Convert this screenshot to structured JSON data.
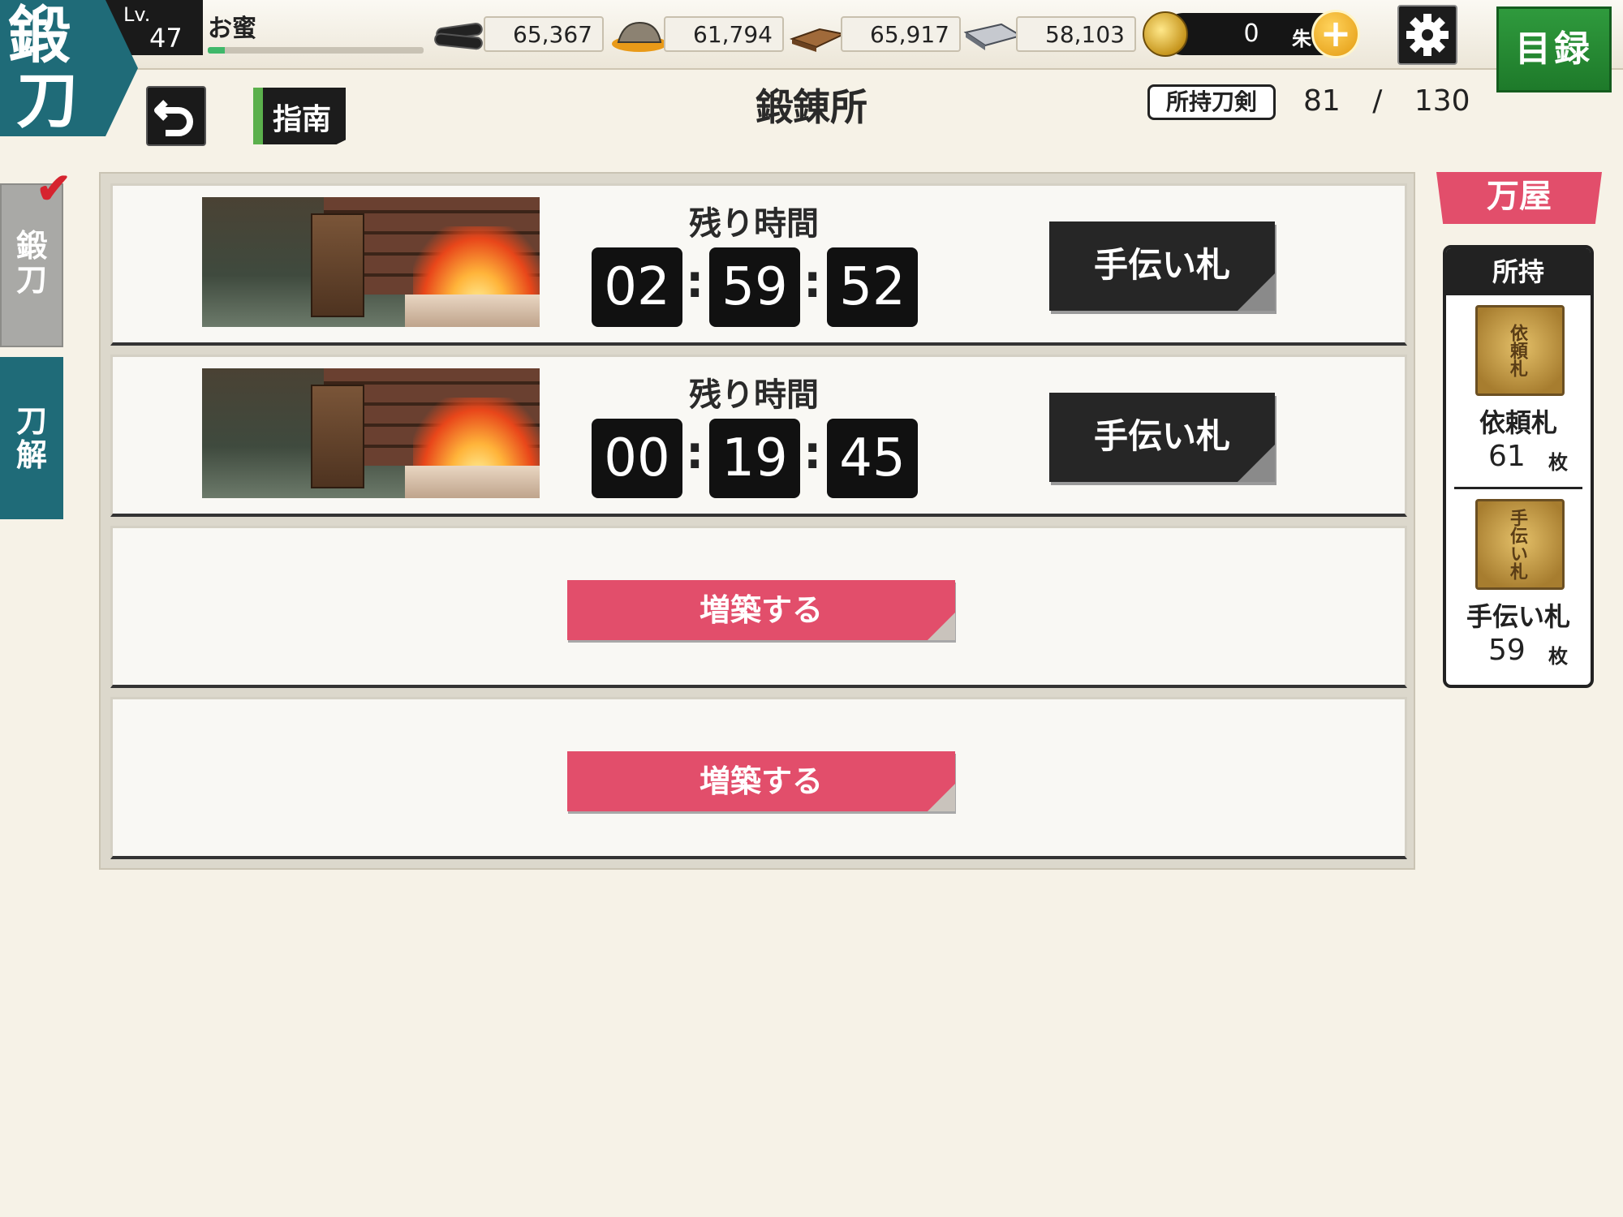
{
  "header": {
    "mode_kanji_1": "鍛",
    "mode_kanji_2": "刀",
    "level_label": "Lv.",
    "level": "47",
    "player_name": "お蜜",
    "exp_progress": 0.08,
    "resources": [
      {
        "icon": "charcoal-icon",
        "value": "65,367"
      },
      {
        "icon": "whetstone-icon",
        "value": "61,794"
      },
      {
        "icon": "tamahagane-icon",
        "value": "65,917"
      },
      {
        "icon": "cooling-material-icon",
        "value": "58,103"
      }
    ],
    "koban": {
      "value": "0",
      "unit": "朱",
      "plus": "+"
    },
    "catalog_label": "目録"
  },
  "nav": {
    "guide_label": "指南"
  },
  "title": "鍛錬所",
  "owned": {
    "label": "所持刀剣",
    "current": "81",
    "separator": "/",
    "max": "130"
  },
  "side_tabs": [
    {
      "label_1": "鍛",
      "label_2": "刀",
      "active": true
    },
    {
      "label_1": "刀",
      "label_2": "解",
      "active": false
    }
  ],
  "slots": [
    {
      "remain_label": "残り時間",
      "h": "02",
      "m": "59",
      "s": "52",
      "button": "手伝い札"
    },
    {
      "remain_label": "残り時間",
      "h": "00",
      "m": "19",
      "s": "45",
      "button": "手伝い札"
    },
    {
      "build_label": "増築する"
    },
    {
      "build_label": "増築する"
    }
  ],
  "shop": {
    "label": "万屋"
  },
  "inventory": {
    "title": "所持",
    "items": [
      {
        "tag_text": "依頼札",
        "name": "依頼札",
        "count": "61",
        "unit": "枚"
      },
      {
        "tag_text": "手伝い札",
        "name": "手伝い札",
        "count": "59",
        "unit": "枚"
      }
    ]
  },
  "colors": {
    "teal": "#1f6b78",
    "pink": "#e24e6b",
    "green": "#2f9a3d"
  }
}
